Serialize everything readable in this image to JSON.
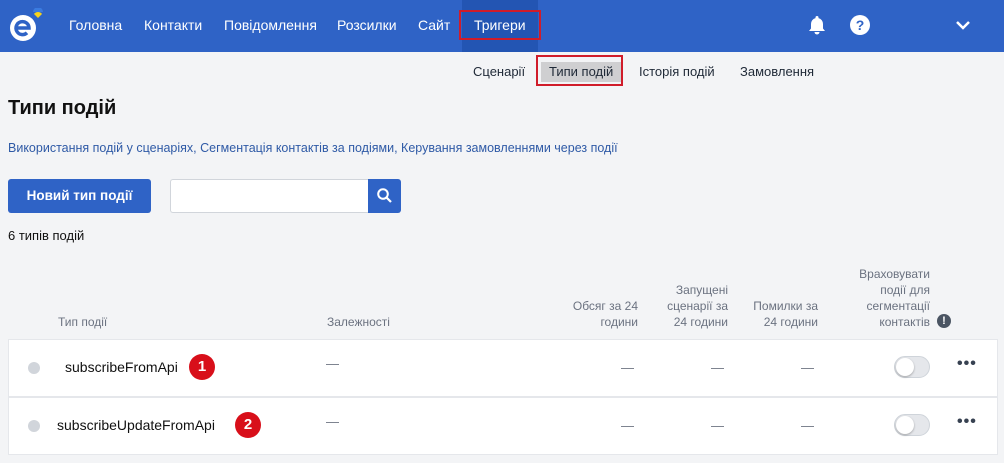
{
  "nav": {
    "items": [
      "Головна",
      "Контакти",
      "Повідомлення",
      "Розсилки",
      "Сайт",
      "Тригери"
    ],
    "active_index": 5
  },
  "icons": {
    "logo": "esputnik-logo",
    "bell": "bell-icon",
    "help": "help-icon",
    "chevron": "chevron-down-icon",
    "search": "search-icon"
  },
  "subtabs": [
    "Сценарії",
    "Типи подій",
    "Історія подій",
    "Замовлення"
  ],
  "page": {
    "title": "Типи подій",
    "links": [
      "Використання подій у сценаріях",
      "Сегментація контактів за подіями",
      "Керування замовленнями через події"
    ],
    "new_button": "Новий тип події",
    "search_placeholder": "",
    "count": "6 типів подій"
  },
  "table": {
    "headers": {
      "type": "Тип події",
      "deps": "Залежності",
      "volume": "Обсяг за 24 години",
      "launched": "Запущені сценарії за 24 години",
      "errors": "Помилки за 24 години",
      "segmentation": "Враховувати події для сегментації контактів"
    },
    "rows": [
      {
        "name": "subscribeFromApi",
        "badge": "1",
        "deps": "—",
        "volume": "—",
        "launched": "—",
        "errors": "—",
        "toggle_on": false
      },
      {
        "name": "subscribeUpdateFromApi",
        "badge": "2",
        "deps": "—",
        "volume": "—",
        "launched": "—",
        "errors": "—",
        "toggle_on": false
      }
    ]
  },
  "colors": {
    "primary": "#2f63c6",
    "highlight": "#d01c2a",
    "badge": "#d80f1a"
  }
}
